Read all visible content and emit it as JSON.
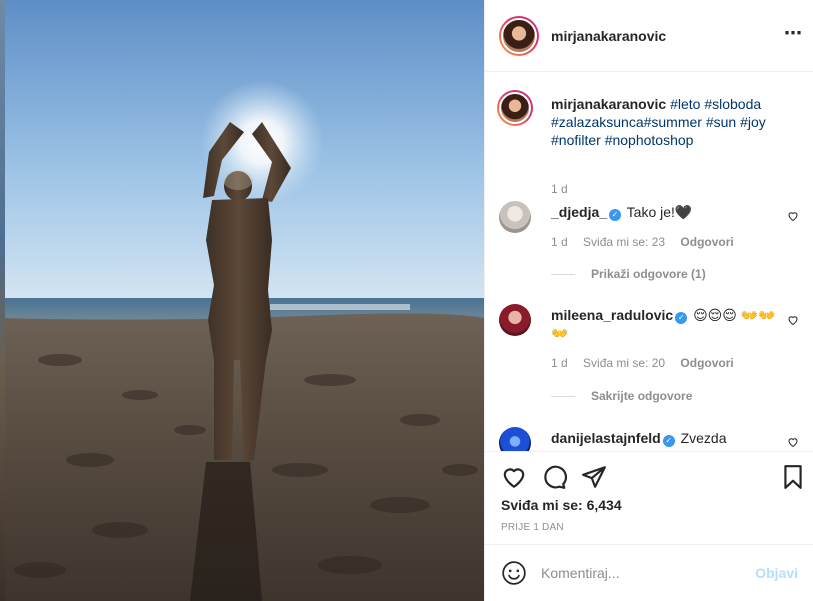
{
  "post": {
    "author": "mirjanakaranovic",
    "caption": {
      "user": "mirjanakaranovic",
      "hashtags": [
        "#leto",
        "#sloboda",
        "#zalazaksunca#summer",
        "#sun",
        "#joy",
        "#nofilter",
        "#nophotoshop"
      ],
      "time": "1 d"
    },
    "more_icon": "⋯"
  },
  "comments": [
    {
      "user": "_djedja_",
      "verified": true,
      "text": "Tako je!🖤",
      "time": "1 d",
      "likes_label": "Sviđa mi se: 23",
      "reply_label": "Odgovori",
      "toggle_label": "Prikaži odgovore (1)"
    },
    {
      "user": "mileena_radulovic",
      "verified": true,
      "text": "😌😌😌 👐👐👐",
      "time": "1 d",
      "likes_label": "Sviđa mi se: 20",
      "reply_label": "Odgovori",
      "toggle_label": "Sakrijte odgovore"
    },
    {
      "user": "danijelastajnfeld",
      "verified": true,
      "text": "Zvezda"
    }
  ],
  "actions": {
    "icons": [
      "heart-icon",
      "comment-icon",
      "share-icon",
      "bookmark-icon"
    ],
    "likes_text": "Sviđa mi se: 6,434",
    "time_ago": "PRIJE 1 DAN"
  },
  "composer": {
    "placeholder": "Komentiraj...",
    "post_label": "Objavi"
  },
  "colors": {
    "link": "#00376b",
    "verified": "#3897f0",
    "muted": "#8e8e8e",
    "post_disabled": "#b2dffc"
  }
}
